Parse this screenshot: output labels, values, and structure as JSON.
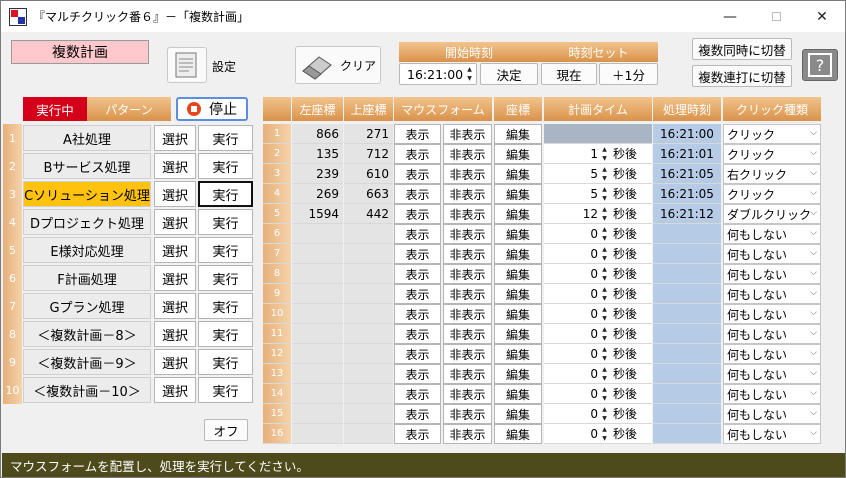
{
  "window": {
    "title": "『マルチクリック番６』－「複数計画」"
  },
  "mode_title": "複数計画",
  "toolbar": {
    "settings_label": "設定",
    "clear_label": "クリア",
    "start_time_header": "開始時刻",
    "time_set_header": "時刻セット",
    "start_time_value": "16:21:00",
    "decide_label": "決定",
    "now_label": "現在",
    "plus_one_label": "＋1分",
    "simul_switch_label": "複数同時に切替",
    "serial_switch_label": "複数連打に切替"
  },
  "patterns": {
    "running_label": "実行中",
    "header": "パターン",
    "stop_label": "停止",
    "select_label": "選択",
    "run_label": "実行",
    "off_label": "オフ",
    "items": [
      {
        "num": "1",
        "name": "A社処理"
      },
      {
        "num": "2",
        "name": "Bサービス処理"
      },
      {
        "num": "3",
        "name": "Cソリューション処理",
        "active": true
      },
      {
        "num": "4",
        "name": "Dプロジェクト処理"
      },
      {
        "num": "5",
        "name": "E様対応処理"
      },
      {
        "num": "6",
        "name": "F計画処理"
      },
      {
        "num": "7",
        "name": "Gプラン処理"
      },
      {
        "num": "8",
        "name": "＜複数計画－8＞"
      },
      {
        "num": "9",
        "name": "＜複数計画－9＞"
      },
      {
        "num": "10",
        "name": "＜複数計画－10＞"
      }
    ]
  },
  "table": {
    "headers": {
      "x": "左座標",
      "y": "上座標",
      "mouse_form": "マウスフォーム",
      "coord": "座標",
      "plan_time": "計画タイム",
      "proc_time": "処理時刻",
      "click_type": "クリック種類"
    },
    "show_label": "表示",
    "hide_label": "非表示",
    "edit_label": "編集",
    "seconds_after": "秒後",
    "rows": [
      {
        "num": "1",
        "x": "866",
        "y": "271",
        "plan": "",
        "proc": "16:21:00",
        "click": "クリック"
      },
      {
        "num": "2",
        "x": "135",
        "y": "712",
        "plan": "1",
        "proc": "16:21:01",
        "click": "クリック"
      },
      {
        "num": "3",
        "x": "239",
        "y": "610",
        "plan": "5",
        "proc": "16:21:05",
        "click": "右クリック"
      },
      {
        "num": "4",
        "x": "269",
        "y": "663",
        "plan": "5",
        "proc": "16:21:05",
        "click": "クリック"
      },
      {
        "num": "5",
        "x": "1594",
        "y": "442",
        "plan": "12",
        "proc": "16:21:12",
        "click": "ダブルクリック"
      },
      {
        "num": "6",
        "x": "",
        "y": "",
        "plan": "0",
        "proc": "",
        "click": "何もしない"
      },
      {
        "num": "7",
        "x": "",
        "y": "",
        "plan": "0",
        "proc": "",
        "click": "何もしない"
      },
      {
        "num": "8",
        "x": "",
        "y": "",
        "plan": "0",
        "proc": "",
        "click": "何もしない"
      },
      {
        "num": "9",
        "x": "",
        "y": "",
        "plan": "0",
        "proc": "",
        "click": "何もしない"
      },
      {
        "num": "10",
        "x": "",
        "y": "",
        "plan": "0",
        "proc": "",
        "click": "何もしない"
      },
      {
        "num": "11",
        "x": "",
        "y": "",
        "plan": "0",
        "proc": "",
        "click": "何もしない"
      },
      {
        "num": "12",
        "x": "",
        "y": "",
        "plan": "0",
        "proc": "",
        "click": "何もしない"
      },
      {
        "num": "13",
        "x": "",
        "y": "",
        "plan": "0",
        "proc": "",
        "click": "何もしない"
      },
      {
        "num": "14",
        "x": "",
        "y": "",
        "plan": "0",
        "proc": "",
        "click": "何もしない"
      },
      {
        "num": "15",
        "x": "",
        "y": "",
        "plan": "0",
        "proc": "",
        "click": "何もしない"
      },
      {
        "num": "16",
        "x": "",
        "y": "",
        "plan": "0",
        "proc": "",
        "click": "何もしない"
      }
    ]
  },
  "status": "マウスフォームを配置し、処理を実行してください。"
}
